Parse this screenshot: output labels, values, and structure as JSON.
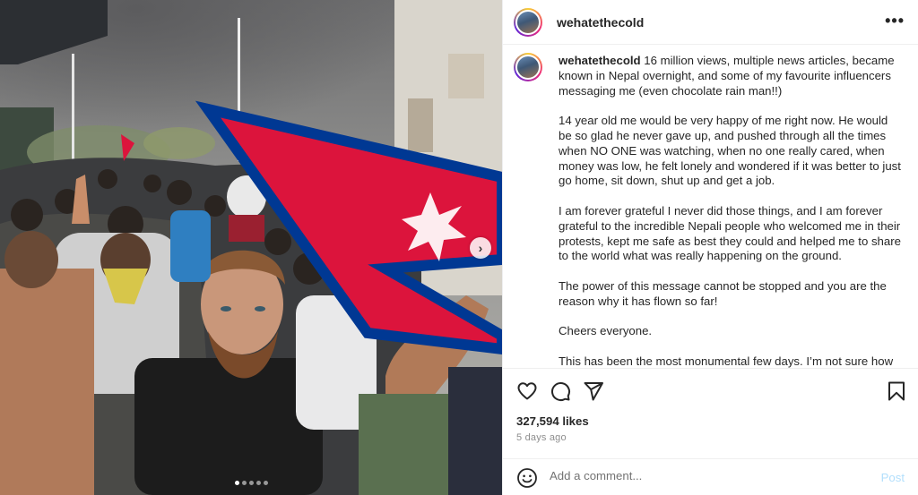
{
  "post": {
    "username": "wehatethecold",
    "caption_paragraphs": [
      "16 million views, multiple news articles, became known in Nepal overnight, and some of my favourite influencers messaging me (even chocolate rain man!!)",
      "14 year old me would be very happy of me right now. He would be so glad he never gave up, and pushed through all the times when NO ONE was watching, when no one really cared, when money was low, he felt lonely and wondered if it was better to just go home, sit down, shut up and get a job.",
      "I am forever grateful I never did those things, and I am forever grateful to the incredible Nepali people who welcomed me in their protests, kept me safe as best they could and helped me to share to the world what was really happening on the ground.",
      "The power of this message cannot be stopped and you are the reason why it has flown so far!",
      "Cheers everyone.",
      "This has been the most monumental few days. I’m not sure how"
    ],
    "likes": "327,594 likes",
    "time": "5 days ago"
  },
  "carousel": {
    "slide_count": 5,
    "active_index": 0,
    "next_symbol": "›"
  },
  "header": {
    "more_symbol": "•••"
  },
  "comment": {
    "placeholder": "Add a comment...",
    "post_label": "Post"
  },
  "icons": {
    "like": "heart-icon",
    "comment": "comment-icon",
    "share": "share-icon",
    "save": "bookmark-icon",
    "emoji": "emoji-icon"
  },
  "colors": {
    "post_button": "#b2dffc",
    "flag_red": "#dc143c",
    "flag_blue": "#003893"
  }
}
